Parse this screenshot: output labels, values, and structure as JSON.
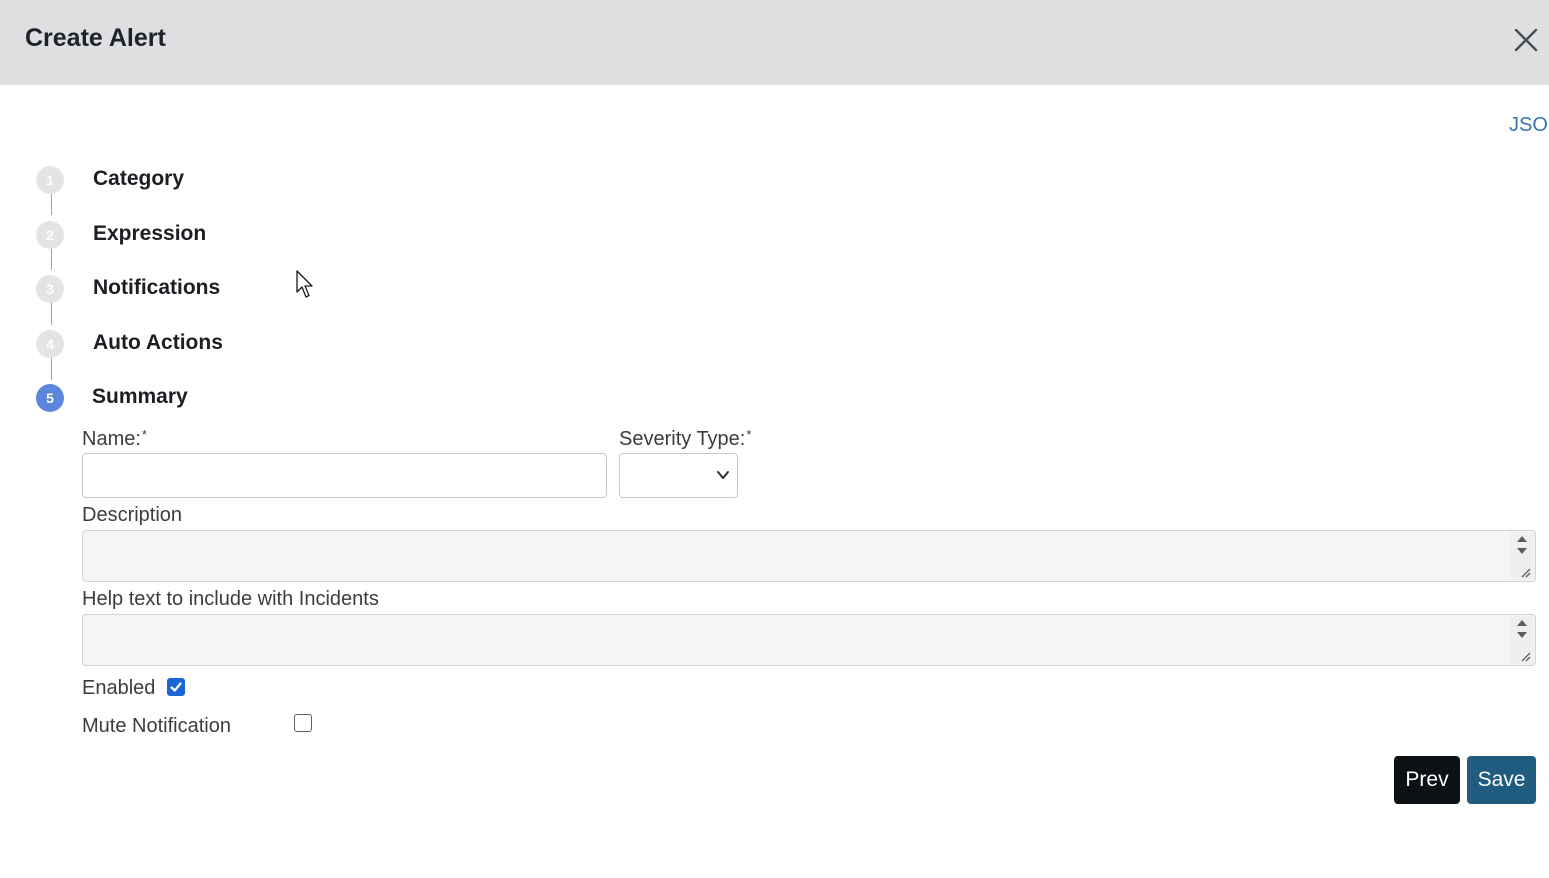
{
  "dialog": {
    "title": "Create Alert",
    "json_link": "JSON"
  },
  "steps": [
    {
      "number": "1",
      "label": "Category",
      "state": "completed"
    },
    {
      "number": "2",
      "label": "Expression",
      "state": "completed"
    },
    {
      "number": "3",
      "label": "Notifications",
      "state": "completed"
    },
    {
      "number": "4",
      "label": "Auto Actions",
      "state": "completed"
    },
    {
      "number": "5",
      "label": "Summary",
      "state": "active"
    }
  ],
  "form": {
    "name_label": "Name:",
    "name_value": "",
    "severity_label": "Severity Type:",
    "severity_value": "",
    "required_marker": "*",
    "description_label": "Description",
    "description_value": "",
    "help_text_label": "Help text to include with Incidents",
    "help_text_value": "",
    "enabled_label": "Enabled",
    "enabled_checked": true,
    "mute_label": "Mute Notification",
    "mute_checked": false
  },
  "buttons": {
    "prev_label": "Prev",
    "save_label": "Save"
  },
  "colors": {
    "header_bg": "#dedfe1",
    "step_active": "#5b86dc",
    "step_inactive": "#e4e4e6",
    "link": "#3a73b7",
    "checkbox_checked": "#1a66d6",
    "prev_button": "#0c1116",
    "save_button": "#1f5c80"
  },
  "icons": {
    "close": "close-icon",
    "dropdown": "chevron-down-icon",
    "checkmark": "check-icon",
    "cursor": "mouse-pointer-icon"
  }
}
